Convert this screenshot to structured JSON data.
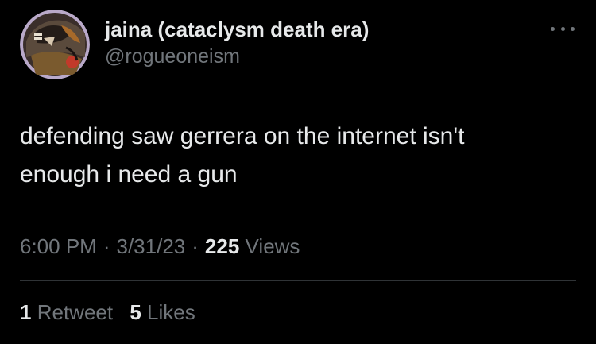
{
  "tweet": {
    "display_name": "jaina (cataclysm death era)",
    "handle": "@rogueoneism",
    "more_icon": "more-horizontal-icon",
    "text_line1": "defending saw gerrera on the internet isn't",
    "text_line2": "enough i need a gun",
    "time": "6:00 PM",
    "separator": "·",
    "date": "3/31/23",
    "views_count": "225",
    "views_label": "Views",
    "retweet_count": "1",
    "retweet_label": "Retweet",
    "like_count": "5",
    "like_label": "Likes"
  },
  "colors": {
    "background": "#000000",
    "primary_text": "#e7e9ea",
    "secondary_text": "#71767b",
    "divider": "#2f3336"
  }
}
